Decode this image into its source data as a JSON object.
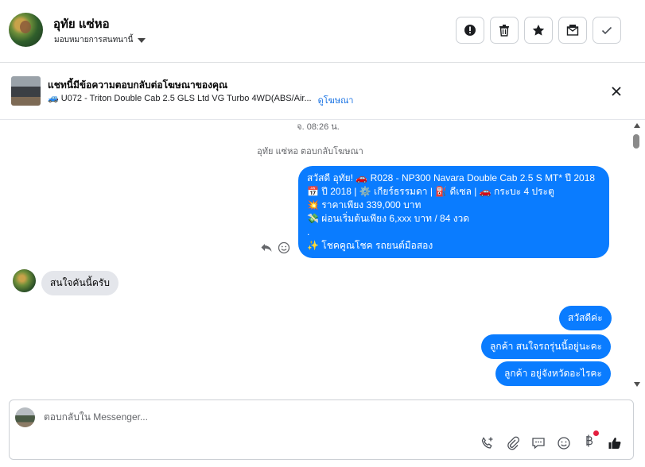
{
  "header": {
    "contact_name": "อุทัย แซ่หอ",
    "assign_label": "มอบหมายการสนทนานี้",
    "actions": [
      {
        "name": "report-button",
        "icon": "exclamation-icon"
      },
      {
        "name": "delete-button",
        "icon": "trash-icon"
      },
      {
        "name": "star-button",
        "icon": "star-icon"
      },
      {
        "name": "mark-unread-button",
        "icon": "envelope-icon"
      },
      {
        "name": "done-button",
        "icon": "check-icon"
      }
    ]
  },
  "ad_banner": {
    "title": "แชทนี้มีข้อความตอบกลับต่อโฆษณาของคุณ",
    "ad_text": "🚙 U072 - Triton Double Cab 2.5 GLS Ltd VG Turbo 4WD(ABS/Air...",
    "view_ad_link": "ดูโฆษณา"
  },
  "conversation": {
    "timestamp": "จ. 08:26 น.",
    "system_note": "อุทัย แซ่หอ ตอบกลับโฆษณา",
    "ad_message_lines": [
      "สวัสดี อุทัย! 🚗 R028 - NP300 Navara Double Cab 2.5 S MT* ปี 2018",
      "📅 ปี 2018 | ⚙️ เกียร์ธรรมดา | ⛽ ดีเซล | 🚗 กระบะ 4 ประตู",
      "💥 ราคาเพียง 339,000 บาท",
      "💸 ผ่อนเริ่มต้นเพียง 6,xxx บาท / 84 งวด",
      ".",
      "✨ โชคคูณโชค รถยนต์มือสอง"
    ],
    "incoming_message": "สนใจคันนี้ครับ",
    "outgoing_messages": [
      "สวัสดีค่ะ",
      "ลูกค้า  สนใจรถรุ่นนี้อยู่นะคะ",
      "ลูกค้า อยู่จังหวัดอะไรคะ"
    ]
  },
  "composer": {
    "placeholder": "ตอบกลับใน Messenger...",
    "tools": [
      "call-add-icon",
      "attachment-icon",
      "saved-reply-icon",
      "emoji-icon",
      "baht-payment-icon",
      "thumbs-up-icon"
    ]
  },
  "colors": {
    "outgoing_bubble": "#0a7cff",
    "incoming_bubble": "#e4e6eb",
    "link": "#1b74e4",
    "notification_dot": "#e41e3f"
  }
}
